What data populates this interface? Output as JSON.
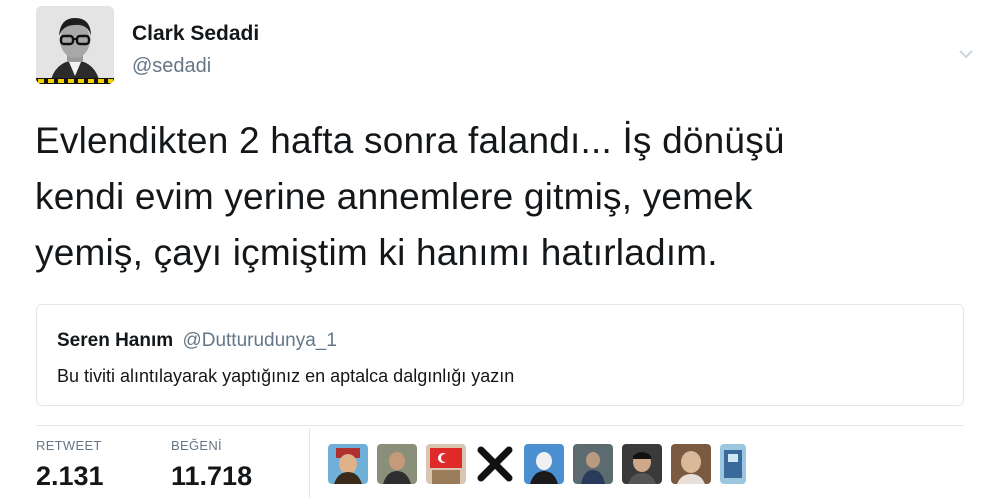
{
  "author": {
    "name": "Clark Sedadi",
    "handle": "@sedadi",
    "avatar_icon": "profile-photo-man-with-glasses"
  },
  "menu_icon": "chevron-down-icon",
  "tweet": {
    "lines": [
      "Evlendikten 2 hafta sonra falandı... İş dönüşü",
      "kendi evim yerine annemlere gitmiş, yemek",
      "yemiş, çayı içmiştim ki hanımı hatırladım."
    ]
  },
  "quoted": {
    "name": "Seren Hanım",
    "handle": "@Dutturudunya_1",
    "text": "Bu tiviti alıntılayarak yaptığınız en aptalca dalgınlığı yazın"
  },
  "stats": {
    "retweet_label": "RETWEET",
    "retweet_count": "2.131",
    "likes_label": "BEĞENİ",
    "likes_count": "11.718"
  },
  "likers": [
    {
      "icon": "liker-avatar-1"
    },
    {
      "icon": "liker-avatar-2"
    },
    {
      "icon": "liker-avatar-3"
    },
    {
      "icon": "liker-avatar-x-icon"
    },
    {
      "icon": "liker-avatar-5"
    },
    {
      "icon": "liker-avatar-6"
    },
    {
      "icon": "liker-avatar-7"
    },
    {
      "icon": "liker-avatar-8"
    },
    {
      "icon": "liker-avatar-9"
    }
  ],
  "colors": {
    "text": "#14171a",
    "muted": "#657786",
    "border": "#e1e8ed"
  }
}
